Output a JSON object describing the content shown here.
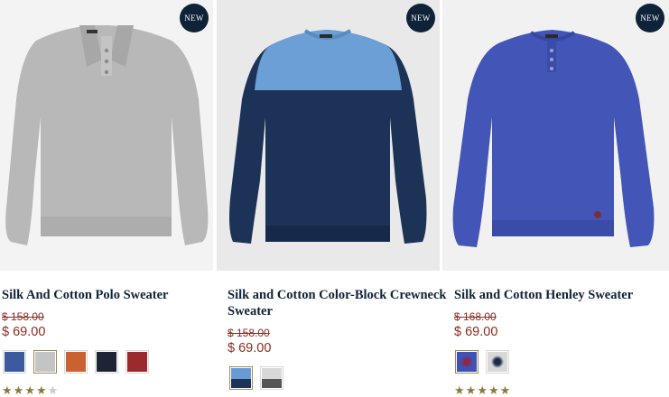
{
  "products": [
    {
      "name": "Silk And Cotton Polo Sweater",
      "badge": "NEW",
      "old_price": "$ 158.00",
      "price": "$ 69.00",
      "swatches": [
        {
          "color": "#3d5a9e",
          "selected": false
        },
        {
          "color": "#c4c4c4",
          "selected": true
        },
        {
          "color": "#c9622e",
          "selected": false
        },
        {
          "color": "#1d2433",
          "selected": false
        },
        {
          "color": "#9a2a2c",
          "selected": false
        }
      ],
      "rating": 4,
      "rating_max": 5
    },
    {
      "name": "Silk and Cotton Color-Block Crewneck Sweater",
      "badge": "NEW",
      "old_price": "$ 158.00",
      "price": "$ 69.00",
      "swatches": [
        {
          "color": "#6a9ad3",
          "selected": true
        },
        {
          "color": "#d0d0d0",
          "selected": false
        }
      ]
    },
    {
      "name": "Silk and Cotton Henley Sweater",
      "badge": "NEW",
      "old_price": "$ 168.00",
      "price": "$ 69.00",
      "swatches": [
        {
          "color": "#3e51b6",
          "selected": true
        },
        {
          "color": "#d8d8d8",
          "selected": false
        }
      ],
      "rating": 5,
      "rating_max": 5
    }
  ],
  "icons": {
    "star": "★"
  }
}
